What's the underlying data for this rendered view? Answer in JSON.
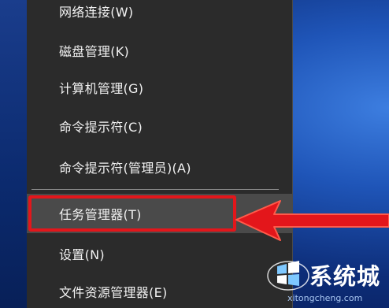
{
  "menu": {
    "items": [
      {
        "label": "网络连接(W)"
      },
      {
        "label": "磁盘管理(K)"
      },
      {
        "label": "计算机管理(G)"
      },
      {
        "label": "命令提示符(C)"
      },
      {
        "label": "命令提示符(管理员)(A)"
      },
      {
        "label": "任务管理器(T)",
        "selected": true
      },
      {
        "label": "设置(N)"
      },
      {
        "label": "文件资源管理器(E)"
      }
    ]
  },
  "annotation": {
    "highlight_color": "#e3161b",
    "arrow_color": "#e3161b",
    "arrow_direction": "left"
  },
  "watermark": {
    "title": "系统城",
    "url": "xitongcheng.com",
    "logo_icon": "windows-logo-icon"
  },
  "colors": {
    "menu_background": "#2b2b2b",
    "selected_background": "#4a4a4a",
    "menu_text": "#f2f2f2",
    "desktop_blue": "#1f55b8"
  }
}
